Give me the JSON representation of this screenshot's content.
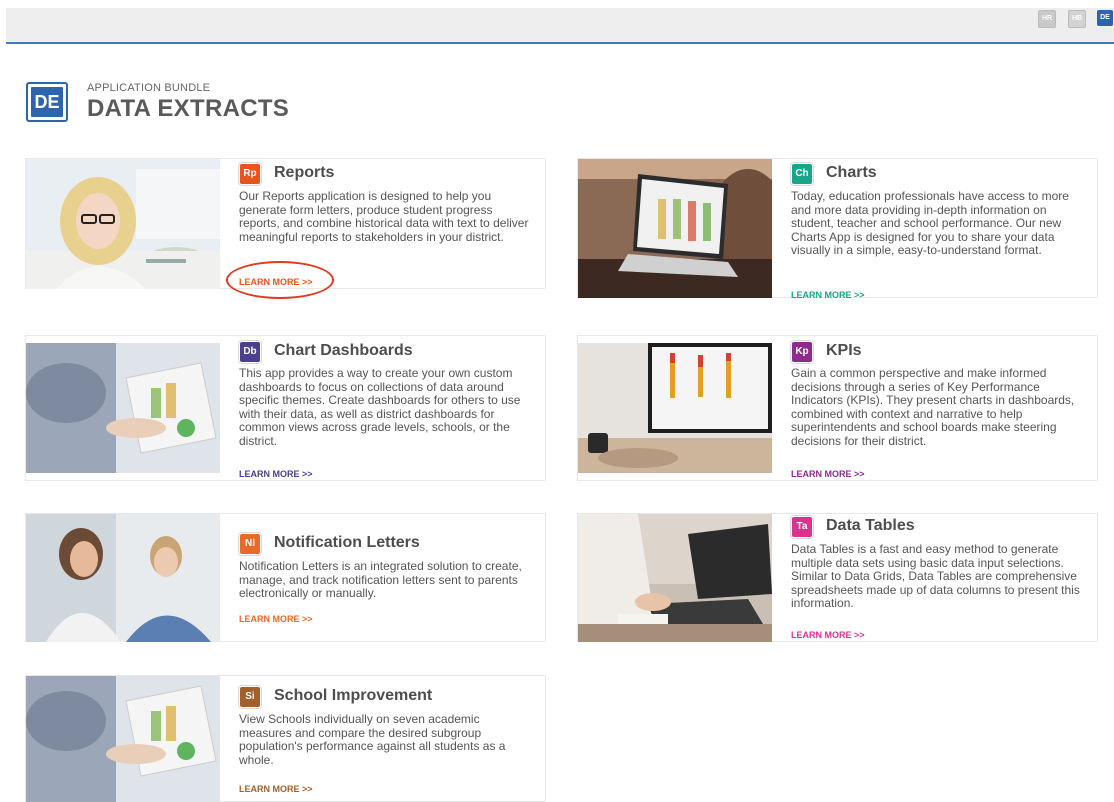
{
  "bundles": {
    "hr": "HR",
    "hb": "HB",
    "de": "DE"
  },
  "header": {
    "logo": "DE",
    "subtitle": "APPLICATION BUNDLE",
    "title": "DATA EXTRACTS"
  },
  "apps": {
    "reports": {
      "abbr": "Rp",
      "color": "#e8541e",
      "title": "Reports",
      "description": "Our Reports application is designed to help you generate form letters, produce student progress reports, and combine historical data with text to deliver meaningful reports to stakeholders in your district.",
      "learn_more": "LEARN MORE >>"
    },
    "charts": {
      "abbr": "Ch",
      "color": "#18a58a",
      "title": "Charts",
      "description": "Today, education professionals have access to more and more data providing in-depth information on student, teacher and school performance. Our new Charts App is designed for you to share your data visually in a simple, easy-to-understand format.",
      "learn_more": "LEARN MORE >>"
    },
    "chart_dashboards": {
      "abbr": "Db",
      "color": "#4b3f8f",
      "title": "Chart Dashboards",
      "description": "This app provides a way to create your own custom dashboards to focus on collections of data around specific themes. Create dashboards for others to use with their data, as well as district dashboards for common views across grade levels, schools, or the district.",
      "learn_more": "LEARN MORE >>"
    },
    "kpis": {
      "abbr": "Kp",
      "color": "#8c2a8e",
      "title": "KPIs",
      "description": "Gain a common perspective and make informed decisions through a series of Key Performance Indicators (KPIs). They present charts in dashboards, combined with context and narrative to help superintendents and school boards make steering decisions for their district.",
      "learn_more": "LEARN MORE >>"
    },
    "notification_letters": {
      "abbr": "Nl",
      "color": "#e8692a",
      "title": "Notification Letters",
      "description": "Notification Letters is an integrated solution to create, manage, and track notification letters sent to parents electronically or manually.",
      "learn_more": "LEARN MORE >>"
    },
    "data_tables": {
      "abbr": "Ta",
      "color": "#d8338f",
      "title": "Data Tables",
      "description": "Data Tables is a fast and easy method to generate multiple data sets using basic data input selections. Similar to Data Grids, Data Tables are comprehensive spreadsheets made up of data columns to present this information.",
      "learn_more": "LEARN MORE >>"
    },
    "school_improvement": {
      "abbr": "Si",
      "color": "#a2612c",
      "title": "School Improvement",
      "description": "View Schools individually on seven academic measures and compare the desired subgroup population's performance against all students as a whole.",
      "learn_more": "LEARN MORE >>"
    }
  }
}
